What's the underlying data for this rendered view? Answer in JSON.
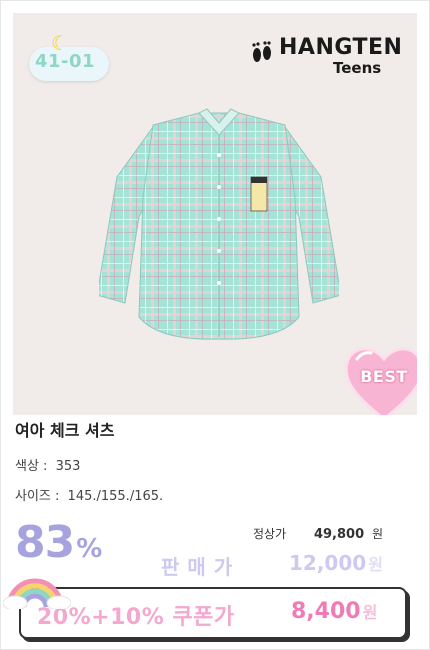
{
  "badge": {
    "code": "41-01",
    "moon_icon": "moon-icon"
  },
  "brand": {
    "logo": "HANGTEN",
    "sub": "Teens"
  },
  "product": {
    "best_label": "BEST",
    "title": "여아 체크 셔츠",
    "color_key": "색상 :",
    "color_value": "353",
    "size_key": "사이즈 :",
    "size_value": "145./155./165."
  },
  "pricing": {
    "discount_number": "83",
    "discount_symbol": "%",
    "list_label": "정상가",
    "list_value": "49,800",
    "list_won": "원",
    "sale_label": "판매가",
    "sale_value": "12,000",
    "sale_won": "원",
    "coupon_label": "20%+10% 쿠폰가",
    "coupon_value": "8,400",
    "coupon_won": "원"
  },
  "colors": {
    "discount": "#a7a3de",
    "sale": "#cdc9ef",
    "coupon_text": "#f4a8cf",
    "coupon_price": "#f07cb6",
    "shirt_base": "#9fe0d4",
    "best_heart": "#f7b5d3"
  }
}
